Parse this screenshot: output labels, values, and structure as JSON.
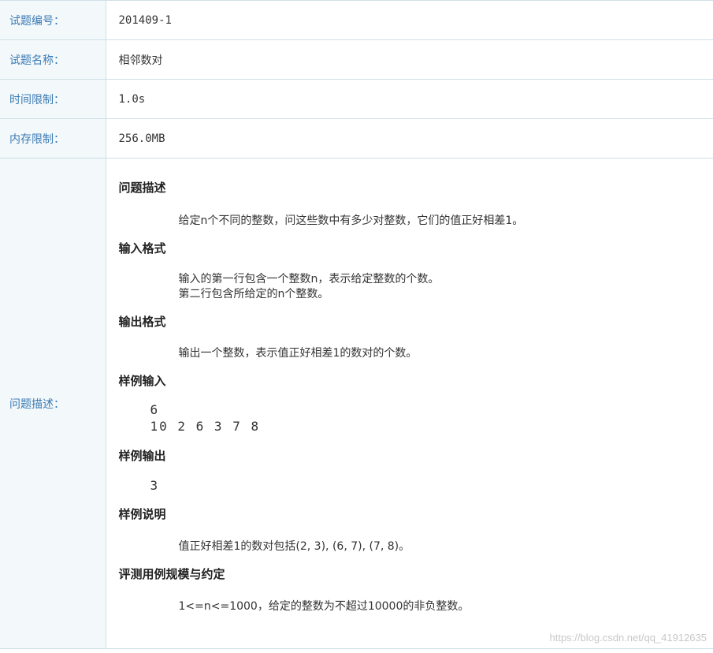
{
  "rows": [
    {
      "label": "试题编号：",
      "value": "201409-1"
    },
    {
      "label": "试题名称：",
      "value": "相邻数对"
    },
    {
      "label": "时间限制：",
      "value": "1.0s"
    },
    {
      "label": "内存限制：",
      "value": "256.0MB"
    }
  ],
  "description": {
    "label": "问题描述：",
    "problem_title": "问题描述",
    "problem_text": "给定n个不同的整数，问这些数中有多少对整数，它们的值正好相差1。",
    "input_title": "输入格式",
    "input_line1": "输入的第一行包含一个整数n，表示给定整数的个数。",
    "input_line2": "第二行包含所给定的n个整数。",
    "output_title": "输出格式",
    "output_text": "输出一个整数，表示值正好相差1的数对的个数。",
    "sample_input_title": "样例输入",
    "sample_input_line1": "6",
    "sample_input_line2": "10 2 6 3 7 8",
    "sample_output_title": "样例输出",
    "sample_output": "3",
    "sample_explain_title": "样例说明",
    "sample_explain": "值正好相差1的数对包括(2, 3), (6, 7), (7, 8)。",
    "constraints_title": "评测用例规模与约定",
    "constraints_text": "1<=n<=1000，给定的整数为不超过10000的非负整数。",
    "watermark": "https://blog.csdn.net/qq_41912635"
  }
}
